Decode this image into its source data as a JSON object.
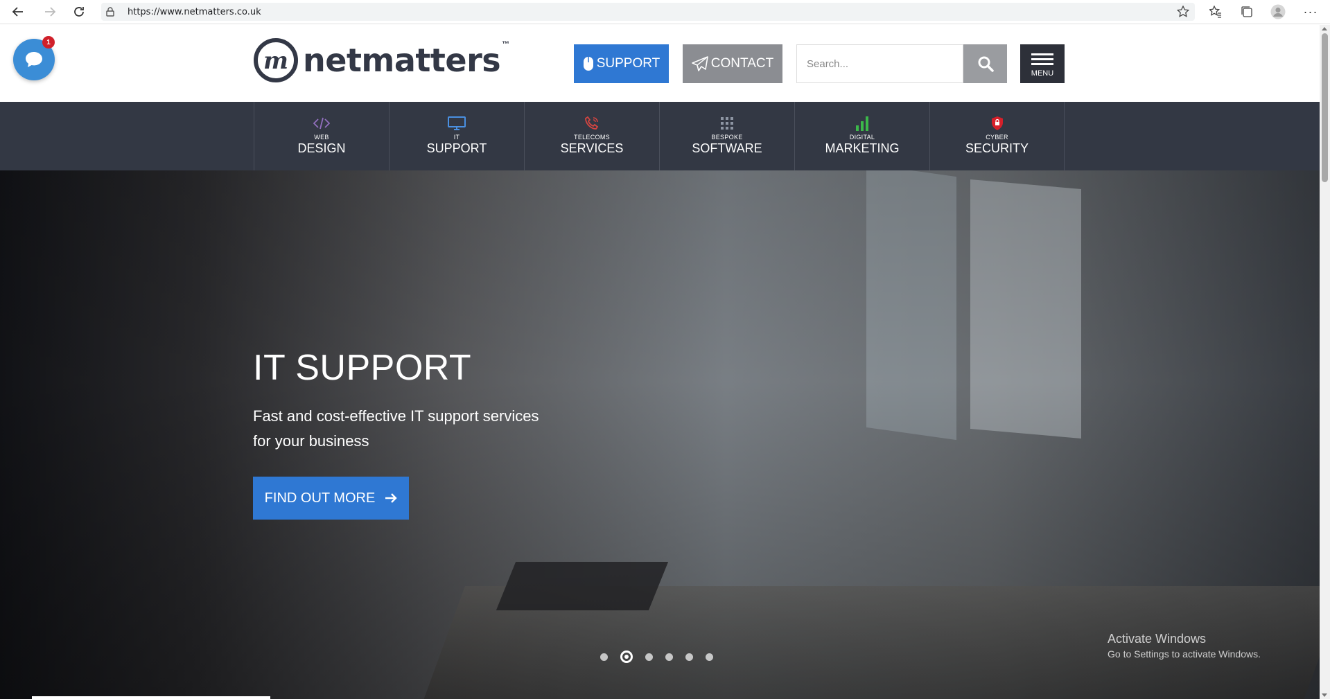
{
  "browser": {
    "url": "https://www.netmatters.co.uk"
  },
  "chat": {
    "badge_count": "1"
  },
  "header": {
    "logo_text": "netmatters",
    "logo_tm": "™",
    "support_label": "SUPPORT",
    "contact_label": "CONTACT",
    "search_placeholder": "Search...",
    "menu_label": "MENU"
  },
  "service_nav": [
    {
      "small": "WEB",
      "big": "DESIGN",
      "icon": "code-icon",
      "color": "#926fbe"
    },
    {
      "small": "IT",
      "big": "SUPPORT",
      "icon": "monitor-icon",
      "color": "#4a90e2"
    },
    {
      "small": "TELECOMS",
      "big": "SERVICES",
      "icon": "phone-icon",
      "color": "#d64541"
    },
    {
      "small": "BESPOKE",
      "big": "SOFTWARE",
      "icon": "grid-icon",
      "color": "#8d95a3"
    },
    {
      "small": "DIGITAL",
      "big": "MARKETING",
      "icon": "bar-chart-icon",
      "color": "#3cb84a"
    },
    {
      "small": "CYBER",
      "big": "SECURITY",
      "icon": "shield-icon",
      "color": "#d6202a"
    }
  ],
  "hero": {
    "title": "IT SUPPORT",
    "subtitle": "Fast and cost-effective IT support services for your business",
    "cta_label": "FIND OUT MORE",
    "slide_count": 6,
    "active_slide": 2
  },
  "watermark": {
    "line1": "Activate Windows",
    "line2": "Go to Settings to activate Windows."
  },
  "colors": {
    "primary_blue": "#2f78d3",
    "nav_dark": "#333844",
    "contact_grey": "#8b8d92"
  }
}
